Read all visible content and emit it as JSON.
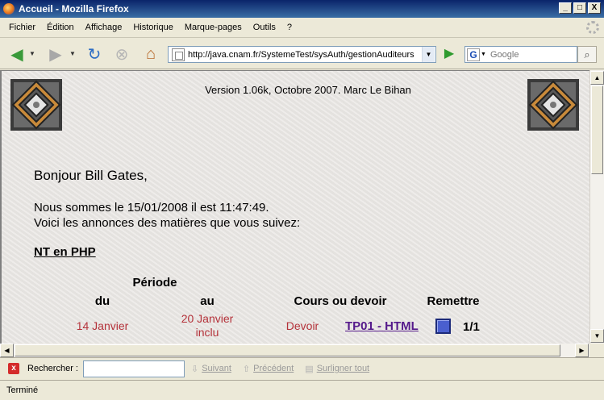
{
  "window": {
    "title": "Accueil - Mozilla Firefox",
    "minimize": "_",
    "maximize": "□",
    "close": "X"
  },
  "menu": [
    "Fichier",
    "Édition",
    "Affichage",
    "Historique",
    "Marque-pages",
    "Outils",
    "?"
  ],
  "navbar": {
    "url": "http://java.cnam.fr/SystemeTest/sysAuth/gestionAuditeurs",
    "search_placeholder": "Google"
  },
  "page": {
    "version": "Version 1.06k, Octobre 2007. Marc Le Bihan",
    "greeting": "Bonjour Bill Gates,",
    "date_line": "Nous sommes le 15/01/2008 il est 11:47:49.",
    "annonces_line": "Voici les annonces des matières que vous suivez:",
    "matiere": "NT en PHP",
    "table": {
      "periode_header": "Période",
      "du_header": "du",
      "au_header": "au",
      "cours_header": "Cours ou devoir",
      "remettre_header": "Remettre",
      "row": {
        "du": "14 Janvier",
        "au_line1": "20 Janvier",
        "au_line2": "inclu",
        "type": "Devoir",
        "link": "TP01 - HTML",
        "count": "1/1"
      }
    }
  },
  "findbar": {
    "label": "Rechercher :",
    "next": "Suivant",
    "previous": "Précédent",
    "highlight": "Surligner tout"
  },
  "status": "Terminé",
  "colors": {
    "accent_red": "#b4323a",
    "visited_link": "#551a8b"
  }
}
